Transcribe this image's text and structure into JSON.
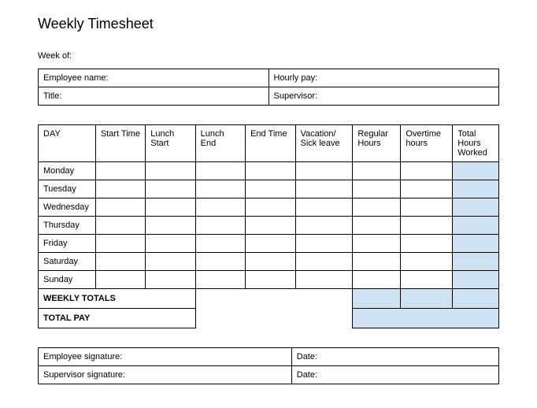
{
  "title": "Weekly Timesheet",
  "week_of_label": "Week of:",
  "info": {
    "employee_name_label": "Employee name:",
    "hourly_pay_label": "Hourly pay:",
    "title_label": "Title:",
    "supervisor_label": "Supervisor:",
    "employee_name_value": "",
    "hourly_pay_value": "",
    "title_value": "",
    "supervisor_value": ""
  },
  "headers": {
    "day": "DAY",
    "start_time": "Start Time",
    "lunch_start": "Lunch Start",
    "lunch_end": "Lunch End",
    "end_time": "End Time",
    "vacation_sick": "Vacation/ Sick leave",
    "regular_hours": "Regular Hours",
    "overtime_hours": "Overtime hours",
    "total_hours": "Total Hours Worked"
  },
  "days": {
    "0": "Monday",
    "1": "Tuesday",
    "2": "Wednesday",
    "3": "Thursday",
    "4": "Friday",
    "5": "Saturday",
    "6": "Sunday"
  },
  "summary": {
    "weekly_totals_label": "WEEKLY TOTALS",
    "total_pay_label": "TOTAL PAY"
  },
  "signatures": {
    "employee_label": "Employee signature:",
    "supervisor_label": "Supervisor signature:",
    "date_label_1": "Date:",
    "date_label_2": "Date:"
  }
}
